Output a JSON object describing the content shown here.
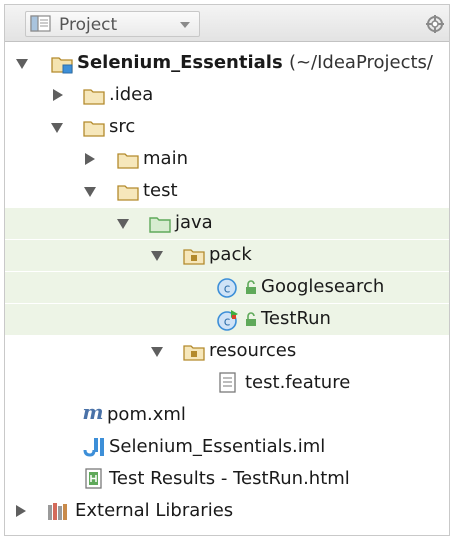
{
  "panel": {
    "title": "Project"
  },
  "tree": {
    "root": {
      "name": "Selenium_Essentials",
      "path": "(~/IdeaProjects/"
    },
    "idea": ".idea",
    "src": "src",
    "main": "main",
    "test": "test",
    "java": "java",
    "pack": "pack",
    "googlesearch": "Googlesearch",
    "testrun": "TestRun",
    "resources": "resources",
    "feature": "test.feature",
    "pom": "pom.xml",
    "iml": "Selenium_Essentials.iml",
    "results": "Test Results - TestRun.html",
    "external": "External Libraries"
  },
  "colors": {
    "folder": "#c7a34d",
    "test_folder": "#5fa95a",
    "selection_bg": "#edf4e6",
    "class_icon": "#3d8fd8"
  },
  "icons": {
    "project": "project-view-icon",
    "settings": "gear-icon",
    "folder": "folder-icon",
    "class": "java-class-icon",
    "lock": "lock-icon"
  }
}
